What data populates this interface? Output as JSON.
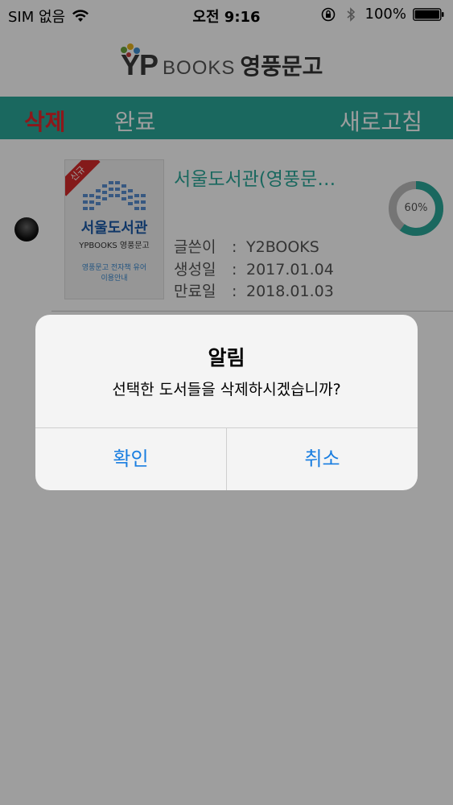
{
  "status_bar": {
    "carrier": "SIM 없음",
    "time": "오전 9:16",
    "battery": "100%"
  },
  "logo": {
    "yp": "YP",
    "books": "BOOKS",
    "korean": "영풍문고"
  },
  "toolbar": {
    "delete_label": "삭제",
    "done_label": "완료",
    "refresh_label": "새로고침"
  },
  "book": {
    "title": "서울도서관(영풍문…",
    "author_label": "글쓴이",
    "author": "Y2BOOKS",
    "created_label": "생성일",
    "created": "2017.01.04",
    "expire_label": "만료일",
    "expire": "2018.01.03",
    "progress_label": "60%",
    "progress": 0.6,
    "cover": {
      "ribbon": "신규",
      "title": "서울도서관",
      "logo": "YPBOOKS 영풍문고",
      "subtitle_1": "영풍문고 전자책 유어",
      "subtitle_2": "이용안내"
    },
    "separator": ":"
  },
  "alert": {
    "title": "알림",
    "message": "선택한 도서들을 삭제하시겠습니까?",
    "ok_label": "확인",
    "cancel_label": "취소"
  },
  "colors": {
    "teal": "#2aa89a",
    "red": "#e4262b",
    "ios_blue": "#1a7ee0"
  }
}
